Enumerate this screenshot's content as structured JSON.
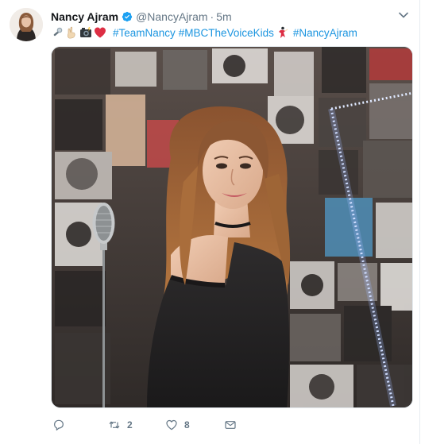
{
  "tweet": {
    "author_name": "Nancy Ajram",
    "handle": "@NancyAjram",
    "separator": "·",
    "time": "5m",
    "emojis": [
      "microphone",
      "victory-hand",
      "camera-with-flash",
      "red-heart"
    ],
    "hashtags": [
      "#TeamNancy",
      "#MBCTheVoiceKids",
      "#NancyAjram"
    ],
    "trailing_emoji": "dancer",
    "replies": "",
    "retweets": "2",
    "likes": "8",
    "colors": {
      "link": "#1b95e0",
      "muted": "#657786",
      "verified": "#1da1f2",
      "heart": "#e0245e"
    }
  }
}
